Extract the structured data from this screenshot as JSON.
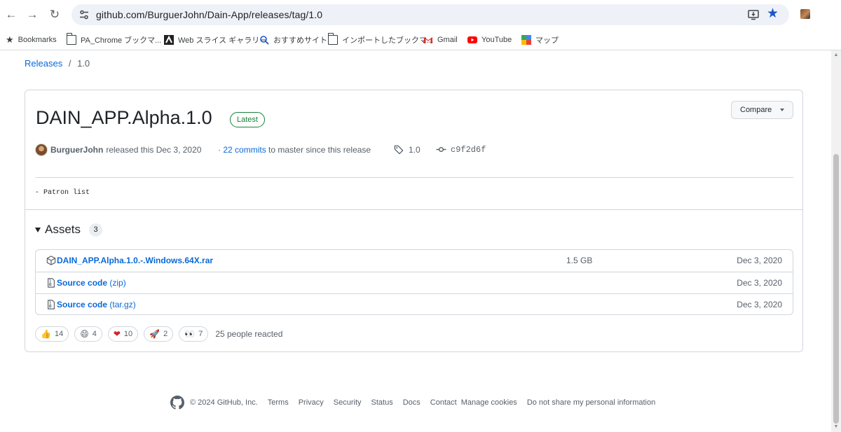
{
  "browser": {
    "url": "github.com/BurguerJohn/Dain-App/releases/tag/1.0",
    "bookmarks": [
      {
        "label": "Bookmarks",
        "icon": "star-icon"
      },
      {
        "label": "PA_Chrome ブックマ...",
        "icon": "folder-icon"
      },
      {
        "label": "Web スライス ギャラリー",
        "icon": "web-slice-icon"
      },
      {
        "label": "おすすめサイト",
        "icon": "search-icon"
      },
      {
        "label": "インポートしたブックマ...",
        "icon": "folder-icon"
      },
      {
        "label": "Gmail",
        "icon": "gmail-icon"
      },
      {
        "label": "YouTube",
        "icon": "youtube-icon"
      },
      {
        "label": "マップ",
        "icon": "maps-icon"
      }
    ]
  },
  "breadcrumb": {
    "releases": "Releases",
    "separator": "/",
    "current": "1.0"
  },
  "release": {
    "title": "DAIN_APP.Alpha.1.0",
    "badge": "Latest",
    "compare_label": "Compare",
    "author": "BurguerJohn",
    "released_text": "released this Dec 3, 2020",
    "commits_link": "22 commits",
    "commits_suffix": "to master since this release",
    "commits_prefix": "·",
    "tag": "1.0",
    "sha": "c9f2d6f",
    "notes": "- Patron list"
  },
  "assets": {
    "title": "Assets",
    "count": "3",
    "items": [
      {
        "name": "DAIN_APP.Alpha.1.0.-.Windows.64X.rar",
        "suffix": "",
        "size": "1.5 GB",
        "date": "Dec 3, 2020"
      },
      {
        "name": "Source code",
        "suffix": "(zip)",
        "size": "",
        "date": "Dec 3, 2020"
      },
      {
        "name": "Source code",
        "suffix": "(tar.gz)",
        "size": "",
        "date": "Dec 3, 2020"
      }
    ]
  },
  "reactions": {
    "items": [
      {
        "emoji": "👍",
        "count": "14"
      },
      {
        "emoji": "😄",
        "count": "4"
      },
      {
        "emoji": "❤",
        "count": "10"
      },
      {
        "emoji": "🚀",
        "count": "2"
      },
      {
        "emoji": "👀",
        "count": "7"
      }
    ],
    "summary": "25 people reacted"
  },
  "footer": {
    "copyright": "© 2024 GitHub, Inc.",
    "links": [
      "Terms",
      "Privacy",
      "Security",
      "Status",
      "Docs",
      "Contact",
      "Manage cookies",
      "Do not share my personal information"
    ]
  },
  "colors": {
    "link": "#0969da",
    "latest": "#1a7f37",
    "star": "#1a57c9"
  }
}
